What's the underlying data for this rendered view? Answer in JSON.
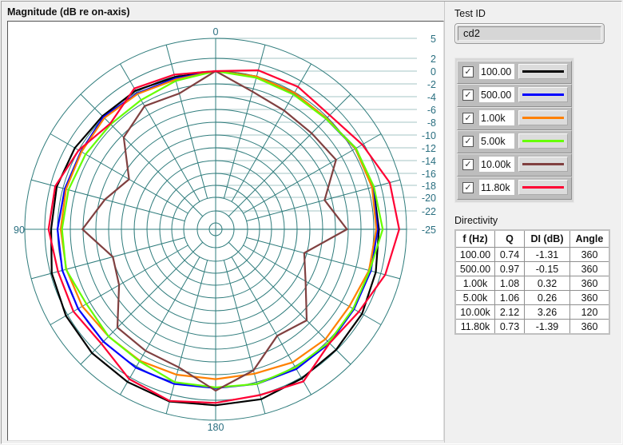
{
  "plot_panel": {
    "title": "Magnitude (dB re on-axis)"
  },
  "test_id": {
    "label": "Test ID",
    "value": "cd2"
  },
  "legend": [
    {
      "label": "100.00",
      "color": "#000000",
      "checked": true
    },
    {
      "label": "500.00",
      "color": "#0000ff",
      "checked": true
    },
    {
      "label": "1.00k",
      "color": "#ff8000",
      "checked": true
    },
    {
      "label": "5.00k",
      "color": "#66ff00",
      "checked": true
    },
    {
      "label": "10.00k",
      "color": "#804040",
      "checked": true
    },
    {
      "label": "11.80k",
      "color": "#ff0033",
      "checked": true
    }
  ],
  "directivity": {
    "label": "Directivity",
    "headers": [
      "f (Hz)",
      "Q",
      "DI (dB)",
      "Angle"
    ],
    "rows": [
      [
        "100.00",
        "0.74",
        "-1.31",
        "360"
      ],
      [
        "500.00",
        "0.97",
        "-0.15",
        "360"
      ],
      [
        "1.00k",
        "1.08",
        "0.32",
        "360"
      ],
      [
        "5.00k",
        "1.06",
        "0.26",
        "360"
      ],
      [
        "10.00k",
        "2.12",
        "3.26",
        "120"
      ],
      [
        "11.80k",
        "0.73",
        "-1.39",
        "360"
      ]
    ]
  },
  "chart_data": {
    "type": "polar-line",
    "title": "Magnitude (dB re on-axis)",
    "angle_labels": [
      "0",
      "90",
      "180"
    ],
    "angle_direction": "counterclockwise, 0 at top",
    "radial_ticks": [
      5,
      2,
      0,
      -2,
      -4,
      -6,
      -8,
      -10,
      -12,
      -14,
      -16,
      -18,
      -20,
      -22,
      -25
    ],
    "radial_range": [
      -25,
      5
    ],
    "angles": [
      0,
      15,
      30,
      45,
      60,
      75,
      90,
      105,
      120,
      135,
      150,
      165,
      180,
      195,
      210,
      225,
      240,
      255,
      270,
      285,
      300,
      315,
      330,
      345
    ],
    "series": [
      {
        "name": "100.00",
        "color": "#000000",
        "values": [
          0,
          -0.1,
          0.3,
          0.3,
          0.7,
          1.0,
          1.0,
          1.8,
          2.3,
          2.6,
          2.8,
          3.1,
          2.75,
          2.75,
          2.2,
          1.9,
          1.7,
          1.2,
          0.8,
          0.8,
          0.6,
          -0.25,
          -0.1,
          0
        ]
      },
      {
        "name": "500.00",
        "color": "#0000ff",
        "values": [
          0,
          -0.3,
          -0.2,
          0.1,
          -0.4,
          -0.3,
          0,
          0.1,
          0.1,
          0.1,
          0.25,
          0.3,
          0.1,
          0.3,
          0.5,
          0.45,
          0.25,
          0.4,
          0.6,
          0.7,
          0.5,
          -0.3,
          -0.2,
          -0.1
        ]
      },
      {
        "name": "1.00k",
        "color": "#ff8000",
        "values": [
          0,
          -0.5,
          -0.3,
          -0.1,
          -0.5,
          -0.5,
          -0.5,
          -0.55,
          -0.65,
          -1.05,
          -1.0,
          -1.2,
          -1.3,
          -1.35,
          -0.7,
          -0.45,
          -0.6,
          0.1,
          0.4,
          0.6,
          0.5,
          -0.2,
          -0.1,
          0
        ]
      },
      {
        "name": "5.00k",
        "color": "#66ff00",
        "values": [
          0,
          -0.7,
          -1.4,
          -1.5,
          -1.25,
          -0.9,
          -0.7,
          -0.5,
          -1.4,
          -1.05,
          -0.9,
          0,
          0,
          0.3,
          0.2,
          0.3,
          0.1,
          0.2,
          1.4,
          0.9,
          0.6,
          -0.3,
          -0.4,
          -0.2
        ]
      },
      {
        "name": "10.00k",
        "color": "#804040",
        "values": [
          0,
          -2.75,
          -2.5,
          -4.4,
          -9.1,
          -6.8,
          -3.9,
          -8.1,
          -7.3,
          -3.0,
          -2.8,
          -2.4,
          0.5,
          -1.9,
          -5.5,
          -4.6,
          -8.5,
          -10.4,
          -4.2,
          -7.1,
          -3.0,
          -3.5,
          -3.3,
          -2.45
        ]
      },
      {
        "name": "11.80k",
        "color": "#ff0033",
        "values": [
          0,
          0.3,
          0.7,
          -1.4,
          0,
          1.25,
          1.4,
          0.8,
          0.95,
          0.55,
          2.3,
          3.0,
          2.4,
          2.1,
          2.7,
          0.45,
          1.1,
          2.7,
          3.9,
          3.4,
          1.75,
          0.5,
          1.0,
          1.0
        ]
      }
    ]
  }
}
